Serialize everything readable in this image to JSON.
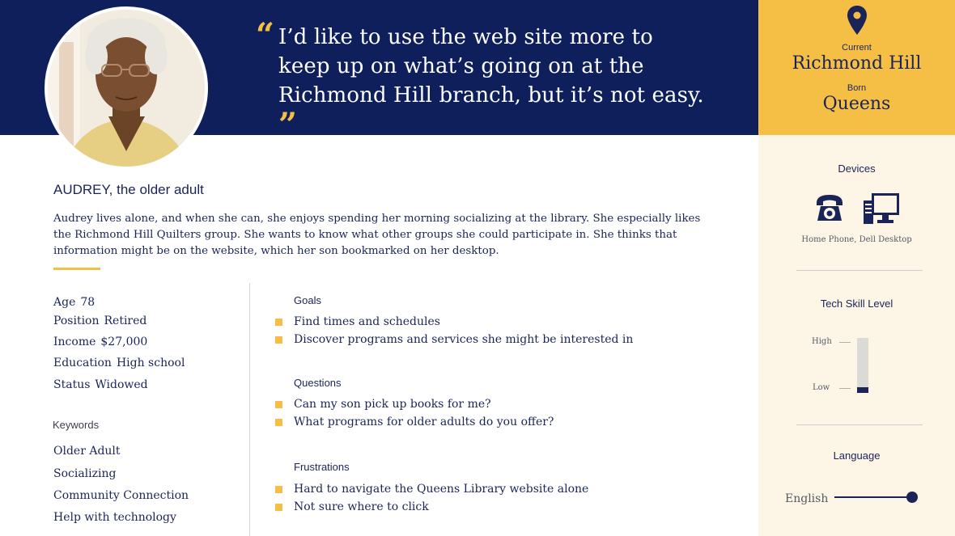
{
  "header": {
    "quote": "I’d like to use the web site more to keep up on what’s going on at the Richmond Hill branch, but it’s not easy.",
    "open_mark": "“",
    "close_mark": "”"
  },
  "location": {
    "current_label": "Current",
    "current": "Richmond Hill",
    "born_label": "Born",
    "born": "Queens"
  },
  "persona": {
    "name": "AUDREY, the older adult",
    "bio": "Audrey lives alone, and when she can, she enjoys spending her morning socializing at the library. She especially likes the Richmond Hill Quilters group. She wants to know what other groups she could participate in. She thinks that information might be on the website, which her son bookmarked on her desktop."
  },
  "attributes": [
    {
      "label": "Age",
      "value": "78"
    },
    {
      "label": "Position",
      "value": "Retired"
    },
    {
      "label": "Income",
      "value": "$27,000"
    },
    {
      "label": "Education",
      "value": "High school"
    },
    {
      "label": "Status",
      "value": "Widowed"
    }
  ],
  "keywords": {
    "title": "Keywords",
    "items": [
      "Older Adult",
      "Socializing",
      "Community Connection",
      "Help with technology"
    ]
  },
  "goals": {
    "title": "Goals",
    "items": [
      "Find times and schedules",
      "Discover programs and services she might be interested in"
    ]
  },
  "questions": {
    "title": "Questions",
    "items": [
      "Can my son pick up books for me?",
      "What programs for older adults do you offer?"
    ]
  },
  "frustrations": {
    "title": "Frustrations",
    "items": [
      "Hard to navigate the Queens Library website alone",
      "Not sure where to click"
    ]
  },
  "devices": {
    "title": "Devices",
    "caption": "Home Phone, Dell Desktop",
    "icons": [
      "telephone-icon",
      "desktop-computer-icon"
    ]
  },
  "tech_skill": {
    "title": "Tech Skill Level",
    "high_label": "High",
    "low_label": "Low",
    "level_fraction": 0.1
  },
  "language": {
    "title": "Language",
    "value": "English",
    "level_fraction": 0.96
  },
  "colors": {
    "navy": "#0e1f5c",
    "accent_yellow": "#f5bf45",
    "sidebar_cream": "#fdf5e6"
  }
}
